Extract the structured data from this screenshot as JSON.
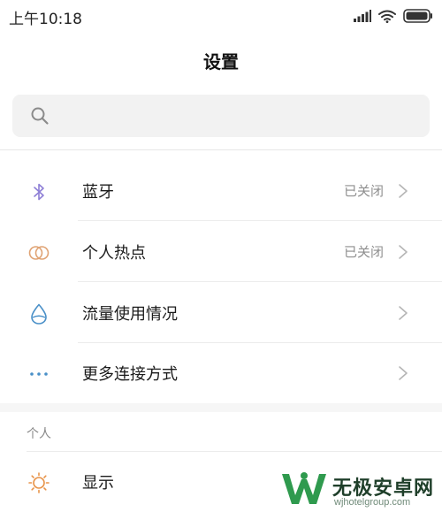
{
  "status_bar": {
    "time": "上午10:18",
    "icons": [
      "signal-icon",
      "wifi-icon",
      "battery-icon"
    ]
  },
  "header": {
    "title": "设置"
  },
  "search": {
    "icon": "search-icon",
    "placeholder": ""
  },
  "connection_items": [
    {
      "label": "蓝牙",
      "value": "已关闭",
      "icon": "bluetooth-icon",
      "color": "#8e7fd6"
    },
    {
      "label": "个人热点",
      "value": "已关闭",
      "icon": "hotspot-icon",
      "color": "#e0a374"
    },
    {
      "label": "流量使用情况",
      "value": "",
      "icon": "data-usage-icon",
      "color": "#4a90c8"
    },
    {
      "label": "更多连接方式",
      "value": "",
      "icon": "more-dots-icon",
      "color": "#4a90c8"
    }
  ],
  "section_personal": {
    "header": "个人",
    "items": [
      {
        "label": "显示",
        "icon": "brightness-icon",
        "color": "#e8944a"
      }
    ]
  },
  "watermark": {
    "title": "无极安卓网",
    "subtitle": "wjhotelgroup.com"
  }
}
